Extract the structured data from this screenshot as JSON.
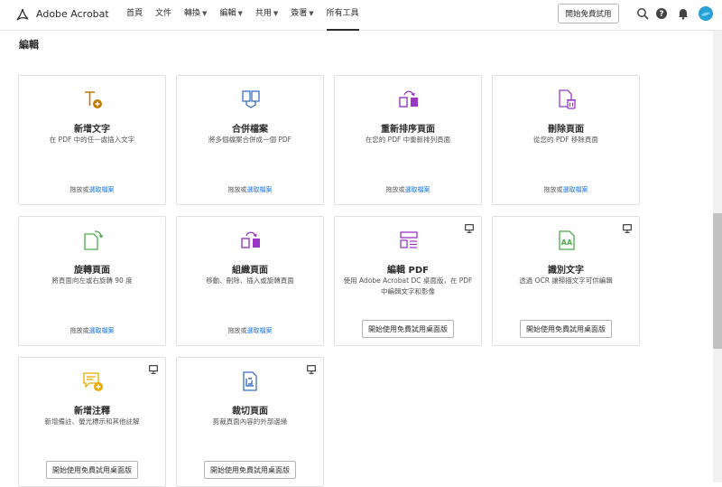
{
  "header": {
    "brand": "Adobe Acrobat",
    "nav": [
      {
        "label": "首頁",
        "chevron": false
      },
      {
        "label": "文件",
        "chevron": false
      },
      {
        "label": "轉換",
        "chevron": true
      },
      {
        "label": "編輯",
        "chevron": true
      },
      {
        "label": "共用",
        "chevron": true
      },
      {
        "label": "簽署",
        "chevron": true
      },
      {
        "label": "所有工具",
        "chevron": false,
        "active": true
      }
    ],
    "trial_label": "開始免費試用"
  },
  "section_title": "編輯",
  "drop_text": "拖放或",
  "select_link": "選取檔案",
  "desktop_button": "開始使用免費試用桌面版",
  "colors": {
    "accent_link": "#1473e6",
    "icon_orange": "#c17a00",
    "icon_blue": "#3a6fc4",
    "icon_purple": "#9a37c7",
    "icon_green": "#4caa4c",
    "icon_yellow": "#e8a900"
  },
  "cards": [
    {
      "title": "新增文字",
      "desc": "在 PDF 中的任一處插入文字",
      "icon": "add-text-icon",
      "desktop": false
    },
    {
      "title": "合併檔案",
      "desc": "將多個檔案合併成一個 PDF",
      "icon": "combine-files-icon",
      "desktop": false
    },
    {
      "title": "重新排序頁面",
      "desc": "在您的 PDF 中重新排列頁面",
      "icon": "reorder-pages-icon",
      "desktop": false
    },
    {
      "title": "刪除頁面",
      "desc": "從您的 PDF 移除頁面",
      "icon": "delete-page-icon",
      "desktop": false
    },
    {
      "title": "旋轉頁面",
      "desc": "將頁面向左或右旋轉 90 度",
      "icon": "rotate-page-icon",
      "desktop": false
    },
    {
      "title": "組織頁面",
      "desc": "移動、刪除、插入或旋轉頁面",
      "icon": "organize-pages-icon",
      "desktop": false
    },
    {
      "title": "編輯 PDF",
      "desc": "使用 Adobe Acrobat DC 桌面版，在 PDF 中編輯文字和影像",
      "icon": "edit-pdf-icon",
      "desktop": true
    },
    {
      "title": "識別文字",
      "desc": "透過 OCR 讓掃描文字可供編輯",
      "icon": "recognize-text-icon",
      "desktop": true
    },
    {
      "title": "新增注釋",
      "desc": "新增備註、螢光標示和其他註解",
      "icon": "add-comment-icon",
      "desktop": true
    },
    {
      "title": "裁切頁面",
      "desc": "剪裁頁面內容的外部邊緣",
      "icon": "crop-page-icon",
      "desktop": true
    }
  ]
}
